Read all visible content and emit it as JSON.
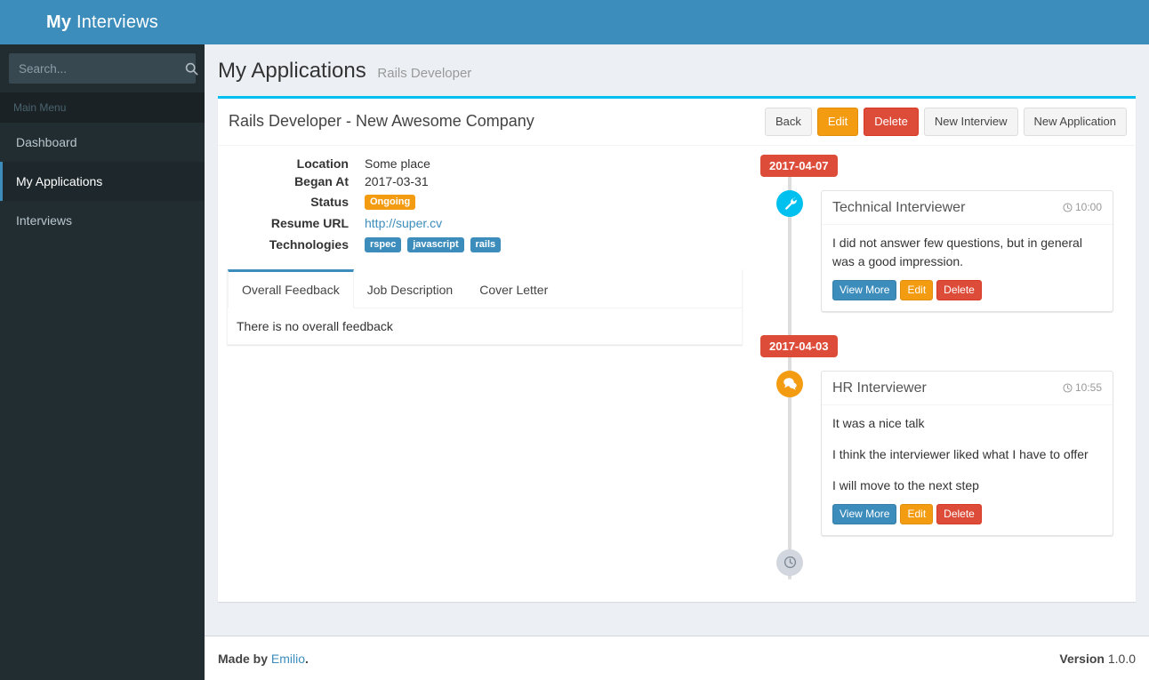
{
  "brand": {
    "strong": "My",
    "rest": "Interviews"
  },
  "sidebar": {
    "search": {
      "placeholder": "Search...",
      "value": "",
      "icon": "search-icon"
    },
    "menu_header": "Main Menu",
    "items": [
      {
        "label": "Dashboard",
        "active": false
      },
      {
        "label": "My Applications",
        "active": true
      },
      {
        "label": "Interviews",
        "active": false
      }
    ]
  },
  "page": {
    "title": "My Applications",
    "subtitle": "Rails Developer"
  },
  "box": {
    "title": "Rails Developer - New Awesome Company",
    "tools": [
      {
        "label": "Back",
        "style": "default"
      },
      {
        "label": "Edit",
        "style": "warning"
      },
      {
        "label": "Delete",
        "style": "danger"
      },
      {
        "label": "New Interview",
        "style": "default"
      },
      {
        "label": "New Application",
        "style": "default"
      }
    ]
  },
  "details": {
    "location_label": "Location",
    "location_value": "Some place",
    "began_label": "Began At",
    "began_value": "2017-03-31",
    "status_label": "Status",
    "status_value": "Ongoing",
    "resume_label": "Resume URL",
    "resume_value": "http://super.cv",
    "technologies_label": "Technologies",
    "technologies": [
      "rspec",
      "javascript",
      "rails"
    ]
  },
  "tabs": {
    "items": [
      {
        "label": "Overall Feedback",
        "active": true
      },
      {
        "label": "Job Description",
        "active": false
      },
      {
        "label": "Cover Letter",
        "active": false
      }
    ],
    "content": "There is no overall feedback"
  },
  "timeline": {
    "groups": [
      {
        "date": "2017-04-07",
        "entries": [
          {
            "icon": "wrench-icon",
            "icon_color": "#00c0ef",
            "title": "Technical Interviewer",
            "time": "10:00",
            "time_icon": "clock-icon",
            "paragraphs": [
              "I did not answer few questions, but in general was a good impression."
            ],
            "actions": [
              {
                "label": "View More",
                "style": "primary"
              },
              {
                "label": "Edit",
                "style": "warning"
              },
              {
                "label": "Delete",
                "style": "danger"
              }
            ]
          }
        ]
      },
      {
        "date": "2017-04-03",
        "entries": [
          {
            "icon": "comments-icon",
            "icon_color": "#f39c12",
            "title": "HR Interviewer",
            "time": "10:55",
            "time_icon": "clock-icon",
            "paragraphs": [
              "It was a nice talk",
              "I think the interviewer liked what I have to offer",
              "I will move to the next step"
            ],
            "actions": [
              {
                "label": "View More",
                "style": "primary"
              },
              {
                "label": "Edit",
                "style": "warning"
              },
              {
                "label": "Delete",
                "style": "danger"
              }
            ]
          }
        ]
      }
    ],
    "end_icon": "clock-icon"
  },
  "footer": {
    "made_by_prefix": "Made by ",
    "made_by_name": "Emilio",
    "made_by_suffix": ".",
    "version_label": "Version",
    "version_value": "1.0.0"
  },
  "colors": {
    "brand_blue": "#3c8dbc",
    "sidebar_dark": "#222d32",
    "accent_aqua": "#00c0ef",
    "warning": "#f39c12",
    "danger": "#dd4b39",
    "page_bg": "#ecf0f5"
  }
}
